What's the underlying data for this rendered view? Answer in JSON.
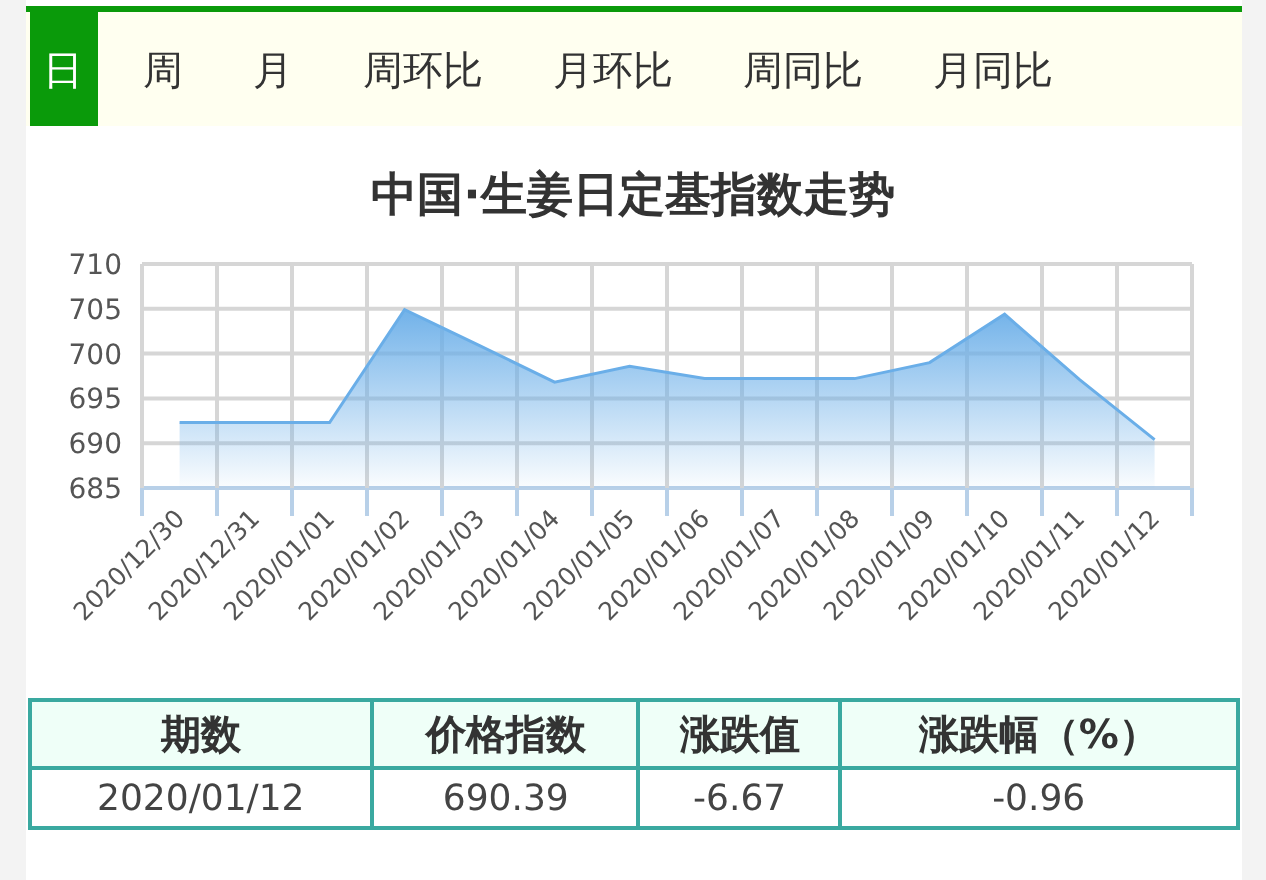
{
  "tabs": [
    {
      "label": "日",
      "selected": true
    },
    {
      "label": "周",
      "selected": false
    },
    {
      "label": "月",
      "selected": false
    },
    {
      "label": "周环比",
      "selected": false
    },
    {
      "label": "月环比",
      "selected": false
    },
    {
      "label": "周同比",
      "selected": false
    },
    {
      "label": "月同比",
      "selected": false
    }
  ],
  "chart": {
    "title": "中国·生姜日定基指数走势",
    "chart_data": {
      "type": "area",
      "categories": [
        "2020/12/30",
        "2020/12/31",
        "2020/01/01",
        "2020/01/02",
        "2020/01/03",
        "2020/01/04",
        "2020/01/05",
        "2020/01/06",
        "2020/01/07",
        "2020/01/08",
        "2020/01/09",
        "2020/01/10",
        "2020/01/11",
        "2020/01/12"
      ],
      "series": [
        {
          "color": "#6aaee8",
          "values": [
            692.3,
            692.3,
            692.3,
            704.9,
            700.9,
            696.8,
            698.6,
            697.2,
            697.2,
            697.2,
            699.0,
            704.4,
            697.1,
            690.4
          ]
        }
      ],
      "grid": true,
      "ylim": [
        685,
        710
      ],
      "yticks": [
        685,
        690,
        695,
        700,
        705,
        710
      ]
    }
  },
  "table": {
    "columns": [
      "期数",
      "价格指数",
      "涨跌值",
      "涨跌幅（%）"
    ],
    "rows": [
      [
        "2020/01/12",
        "690.39",
        "-6.67",
        "-0.96"
      ]
    ]
  }
}
